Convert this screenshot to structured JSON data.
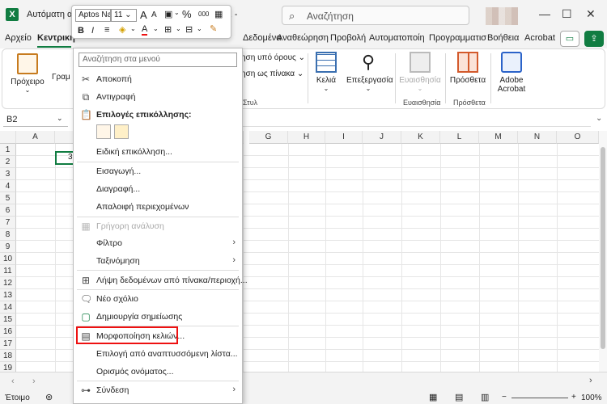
{
  "window": {
    "title_left": "Αυτόματη απο",
    "title_right": "io1  -",
    "search_placeholder": "Αναζήτηση"
  },
  "tabs": [
    "Αρχείο",
    "Κεντρική",
    "Δεδομένα",
    "Αναθεώρηση",
    "Προβολή",
    "Αυτοματοποίη",
    "Προγραμματισ",
    "Βοήθεια",
    "Acrobat"
  ],
  "ribbon": {
    "paste_label": "Πρόχειρο",
    "font_label_partial": "Γραμ",
    "cond_format": "ηση υπό όρους",
    "format_table": "ηση ως πίνακα",
    "styles_group": "Στυλ",
    "cells_label": "Κελιά",
    "editing_label": "Επεξεργασία",
    "sensitivity_label": "Ευαισθησία",
    "sensitivity_group": "Ευαισθησία",
    "addins_label": "Πρόσθετα",
    "addins_group": "Πρόσθετα",
    "adobe_label_1": "Adobe",
    "adobe_label_2": "Acrobat"
  },
  "formula_bar": {
    "name_box": "B2"
  },
  "grid": {
    "columns": [
      "A",
      "B",
      "C",
      "D",
      "E",
      "F",
      "G",
      "H",
      "I",
      "J",
      "K",
      "L",
      "M",
      "N",
      "O"
    ],
    "rows": [
      "1",
      "2",
      "3",
      "4",
      "5",
      "6",
      "7",
      "8",
      "9",
      "10",
      "11",
      "12",
      "13",
      "14",
      "15",
      "16",
      "17",
      "18",
      "19"
    ],
    "b2_value": "3"
  },
  "mini_toolbar": {
    "font": "Aptos Na",
    "size": "11",
    "grow": "A",
    "shrink": "A",
    "percent": "%",
    "thousands": "000",
    "bold": "B",
    "italic": "I"
  },
  "context_menu": {
    "search_placeholder": "Αναζήτηση στα μενού",
    "items": [
      {
        "label": "Αποκοπή"
      },
      {
        "label": "Αντιγραφή"
      },
      {
        "label": "Επιλογές επικόλλησης:"
      },
      {
        "label": "Ειδική επικόλληση..."
      },
      {
        "label": "Εισαγωγή..."
      },
      {
        "label": "Διαγραφή..."
      },
      {
        "label": "Απαλοιφή περιεχομένων"
      },
      {
        "label": "Γρήγορη ανάλυση"
      },
      {
        "label": "Φίλτρο"
      },
      {
        "label": "Ταξινόμηση"
      },
      {
        "label": "Λήψη δεδομένων από πίνακα/περιοχή..."
      },
      {
        "label": "Νέο σχόλιο"
      },
      {
        "label": "Δημιουργία σημείωσης"
      },
      {
        "label": "Μορφοποίηση κελιών..."
      },
      {
        "label": "Επιλογή από αναπτυσσόμενη λίστα..."
      },
      {
        "label": "Ορισμός ονόματος..."
      },
      {
        "label": "Σύνδεση"
      }
    ]
  },
  "status": {
    "ready": "Έτοιμο",
    "zoom": "100%"
  },
  "colors": {
    "brand": "#107c41",
    "highlight": "#e11111"
  }
}
